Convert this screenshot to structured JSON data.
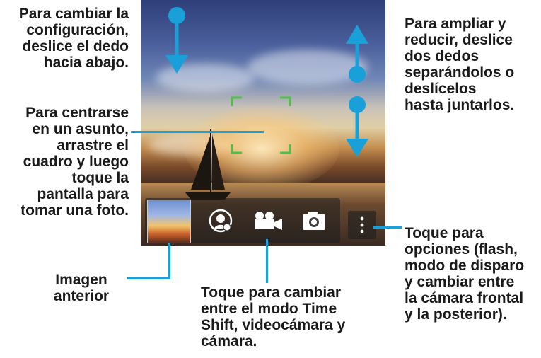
{
  "callouts": {
    "settings": "Para cambiar la\nconfiguración,\ndeslice el dedo\nhacia abajo.",
    "zoom": "Para ampliar y\nreducir, deslice\ndos dedos\nseparándolos o\ndeslícelos\nhasta juntarlos.",
    "focus": "Para centrarse\nen un asunto,\narrastre el\ncuadro y luego\ntoque la\npantalla para\ntomar una foto.",
    "options": "Toque para\nopciones (flash,\nmodo de disparo\ny cambiar entre\nla cámara frontal\ny la posterior).",
    "previous": "Imagen\nanterior",
    "modes": "Toque para cambiar\nentre el modo Time\nShift, videocámara y\ncámara."
  },
  "icons": {
    "settings_gesture": "arrow-down-swipe-icon",
    "zoom_out_gesture": "arrow-up-swipe-icon",
    "zoom_in_gesture": "arrow-down-swipe-icon",
    "focus_frame": "focus-frame-icon",
    "time_shift": "time-shift-icon",
    "video": "video-camera-icon",
    "camera": "camera-icon",
    "options": "more-options-icon"
  },
  "colors": {
    "accent": "#1aa0d8",
    "focus": "#4fbf47"
  }
}
